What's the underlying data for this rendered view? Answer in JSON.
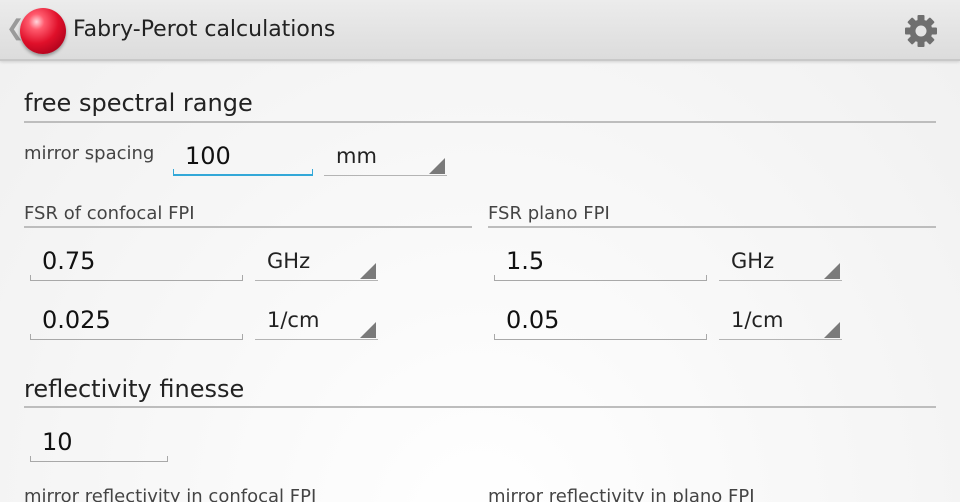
{
  "actionbar": {
    "title": "Fabry-Perot calculations",
    "up_caret": "❮",
    "app_icon": "red-sphere-icon",
    "settings_icon": "gear-icon"
  },
  "free_spectral_range": {
    "title": "free spectral range",
    "mirror_spacing_label": "mirror spacing",
    "mirror_spacing_value": "100",
    "mirror_spacing_unit": "mm",
    "confocal": {
      "title": "FSR of confocal FPI",
      "value_1": "0.75",
      "unit_1": "GHz",
      "value_2": "0.025",
      "unit_2": "1/cm"
    },
    "plano": {
      "title": "FSR plano FPI",
      "value_1": "1.5",
      "unit_1": "GHz",
      "value_2": "0.05",
      "unit_2": "1/cm"
    }
  },
  "reflectivity_finesse": {
    "title": "reflectivity finesse",
    "value": "10",
    "confocal_label": "mirror reflectivity in confocal FPI",
    "plano_label": "mirror reflectivity in plano FPI"
  },
  "colors": {
    "accent_focus": "#33a8d8",
    "icon_red": "#e0102a",
    "rule_gray": "#bdbdbd"
  }
}
